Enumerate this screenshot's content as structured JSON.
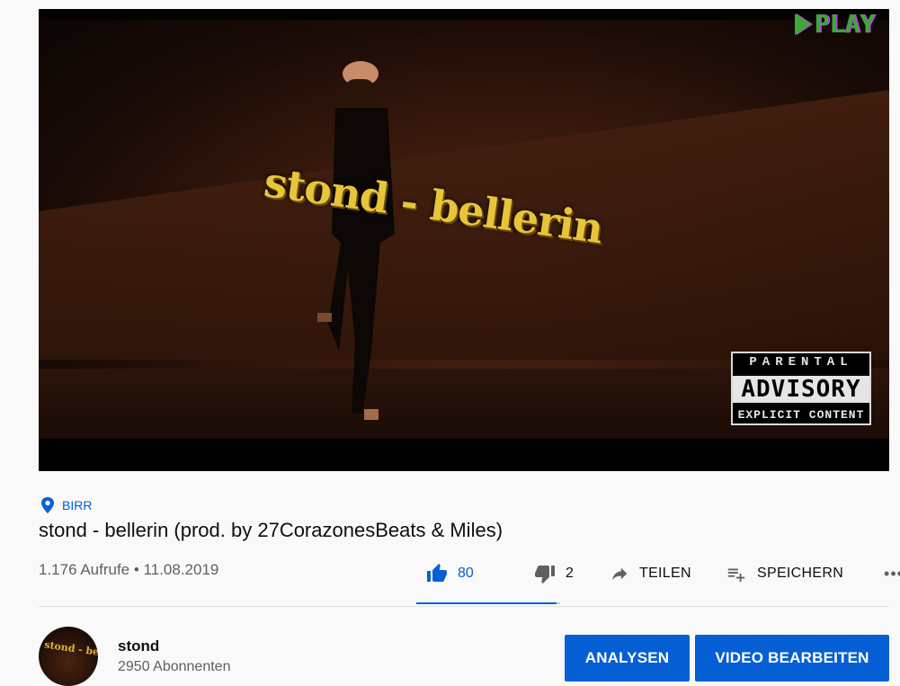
{
  "video": {
    "overlay_title": "stond - bellerin",
    "watermark": "PLAY",
    "advisory": {
      "top": "PARENTAL",
      "middle": "ADVISORY",
      "bottom": "EXPLICIT CONTENT"
    }
  },
  "location": "BIRR",
  "title": "stond - bellerin (prod. by 27CorazonesBeats & Miles)",
  "meta": {
    "views": "1.176 Aufrufe",
    "separator": " • ",
    "date": "11.08.2019"
  },
  "actions": {
    "likes": "80",
    "dislikes": "2",
    "share_label": "TEILEN",
    "save_label": "SPEICHERN",
    "more_label": "•••",
    "like_ratio": 0.976
  },
  "channel": {
    "name": "stond",
    "subscribers": "2950 Abonnenten",
    "avatar_text": "stond - bellerin"
  },
  "buttons": {
    "analytics": "ANALYSEN",
    "edit": "VIDEO BEARBEITEN"
  },
  "colors": {
    "accent": "#065fd4",
    "text_secondary": "#606060"
  }
}
